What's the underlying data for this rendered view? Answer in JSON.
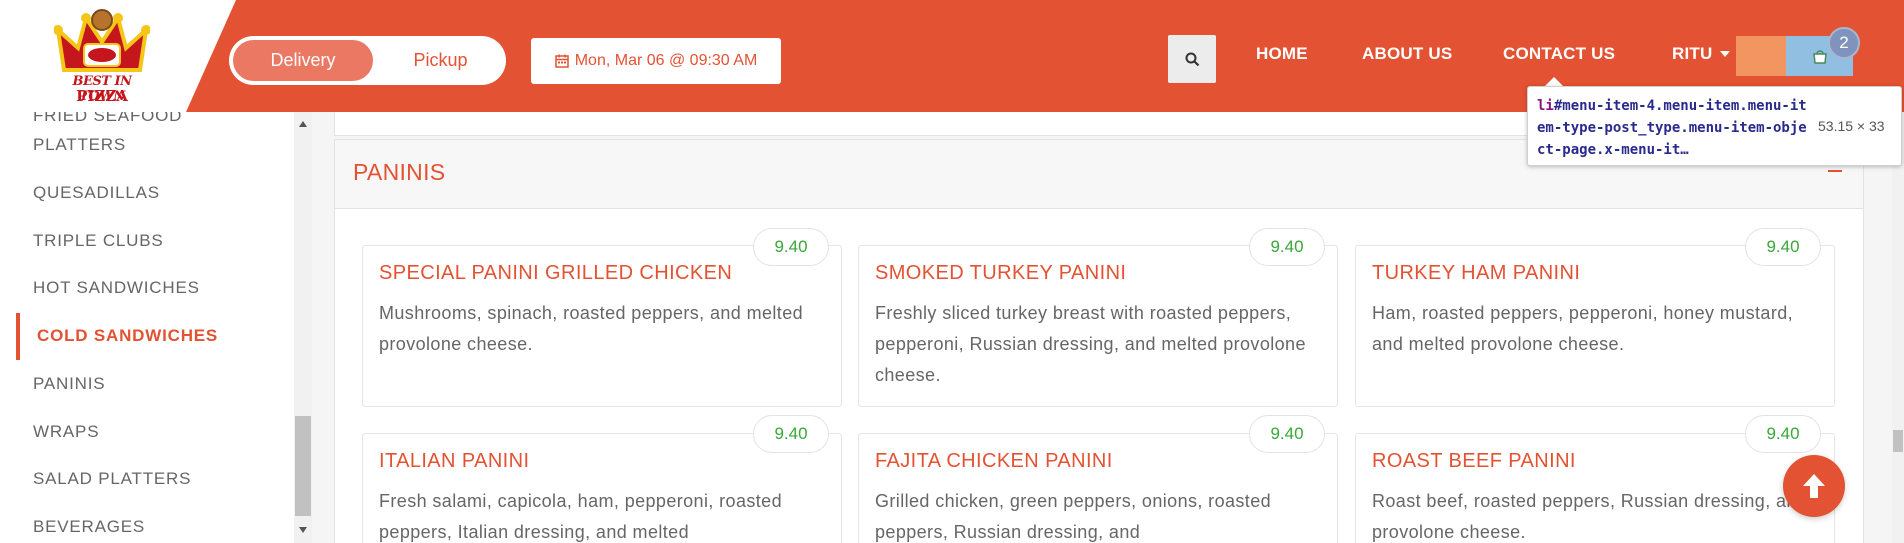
{
  "brand": {
    "logo_line1": "BEST IN TOWN",
    "logo_line2": "PIZZA"
  },
  "order_type": {
    "options": [
      "Delivery",
      "Pickup"
    ],
    "selected": "Delivery"
  },
  "schedule": {
    "label": "Mon, Mar 06 @ 09:30 AM",
    "icon": "calendar-icon"
  },
  "nav": {
    "items": [
      "HOME",
      "ABOUT US",
      "CONTACT US"
    ],
    "user": "RITU",
    "cart_count": "2"
  },
  "tooltip": {
    "selector_tag": "li",
    "selector_rest": "#menu-item-4.menu-item.menu-item-type-post_type.menu-item-object-page.x-menu-it…",
    "size": "53.15 × 33"
  },
  "sidebar": {
    "items": [
      "FRIED SEAFOOD",
      "PLATTERS",
      "QUESADILLAS",
      "TRIPLE CLUBS",
      "HOT SANDWICHES",
      "COLD SANDWICHES",
      "PANINIS",
      "WRAPS",
      "SALAD PLATTERS",
      "BEVERAGES"
    ],
    "active": "COLD SANDWICHES"
  },
  "section": {
    "title": "PANINIS"
  },
  "products": [
    {
      "name": "SPECIAL PANINI GRILLED CHICKEN",
      "desc": "Mushrooms, spinach, roasted peppers, and melted provolone cheese.",
      "price": "9.40"
    },
    {
      "name": "SMOKED TURKEY PANINI",
      "desc": "Freshly sliced turkey breast with roasted peppers, pepperoni, Russian dressing, and melted provolone cheese.",
      "price": "9.40"
    },
    {
      "name": "TURKEY HAM PANINI",
      "desc": "Ham, roasted peppers, pepperoni, honey mustard, and melted provolone cheese.",
      "price": "9.40"
    },
    {
      "name": "ITALIAN PANINI",
      "desc": "Fresh salami, capicola, ham, pepperoni, roasted peppers, Italian dressing, and melted",
      "price": "9.40"
    },
    {
      "name": "FAJITA CHICKEN PANINI",
      "desc": "Grilled chicken, green peppers, onions, roasted peppers, Russian dressing, and",
      "price": "9.40"
    },
    {
      "name": "ROAST BEEF PANINI",
      "desc": "Roast beef, roasted peppers, Russian dressing, and provolone cheese.",
      "price": "9.40"
    }
  ],
  "colors": {
    "brand": "#e35232",
    "price": "#3aa63a"
  }
}
